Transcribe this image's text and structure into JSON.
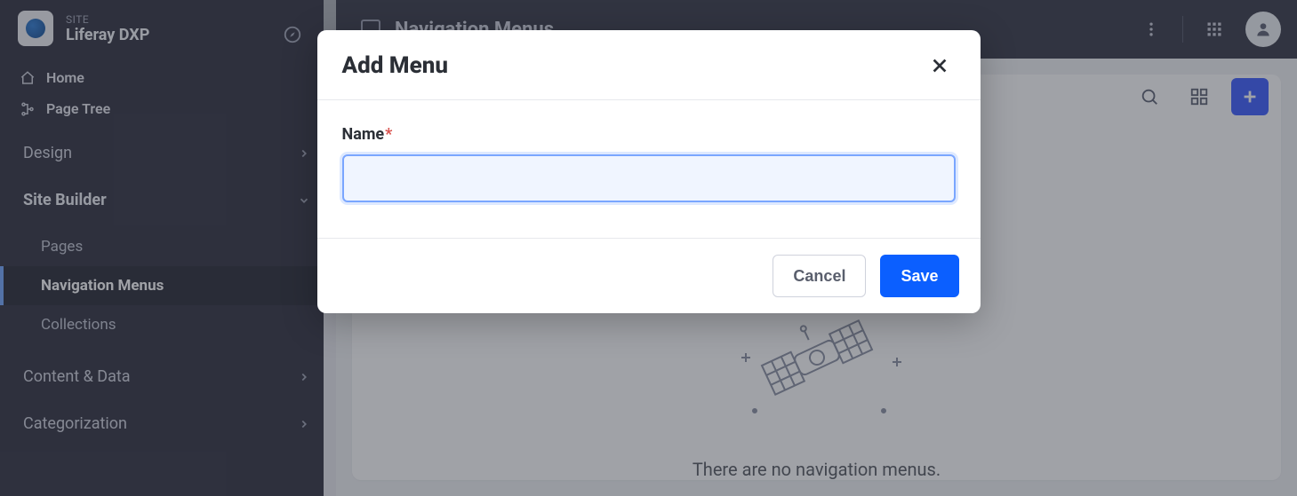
{
  "sidebar": {
    "eyebrow": "SITE",
    "title": "Liferay DXP",
    "links": {
      "home": "Home",
      "page_tree": "Page Tree"
    },
    "sections": {
      "design": "Design",
      "site_builder": "Site Builder",
      "content_data": "Content & Data",
      "categorization": "Categorization"
    },
    "site_builder_items": {
      "pages": "Pages",
      "navigation_menus": "Navigation Menus",
      "collections": "Collections"
    }
  },
  "main": {
    "page_title": "Navigation Menus",
    "empty_message": "There are no navigation menus."
  },
  "modal": {
    "title": "Add Menu",
    "name_label": "Name",
    "required_mark": "*",
    "name_value": "",
    "cancel": "Cancel",
    "save": "Save"
  }
}
